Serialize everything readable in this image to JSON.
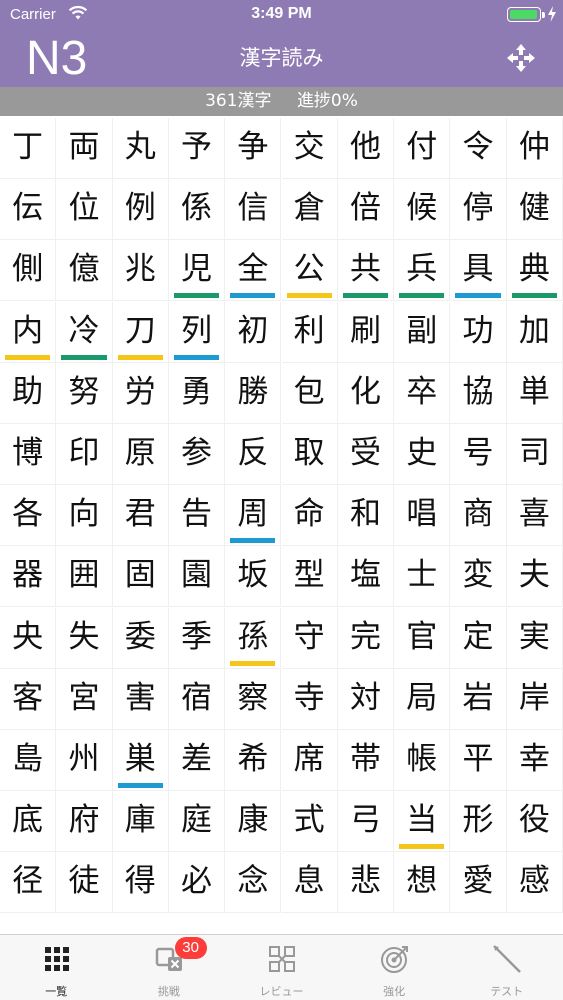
{
  "status_bar": {
    "carrier": "Carrier",
    "time": "3:49 PM"
  },
  "header": {
    "level": "N3",
    "title": "漢字読み",
    "shuffle_icon": "shuffle-icon"
  },
  "progress": {
    "count_text": "361漢字",
    "progress_text": "進捗0%"
  },
  "colors": {
    "theme": "#8f7bb4",
    "green": "#1a9a6b",
    "yellow": "#f5c517",
    "blue": "#1d9bd1"
  },
  "grid": {
    "cells": [
      {
        "k": "丁",
        "mark": ""
      },
      {
        "k": "両",
        "mark": ""
      },
      {
        "k": "丸",
        "mark": ""
      },
      {
        "k": "予",
        "mark": ""
      },
      {
        "k": "争",
        "mark": ""
      },
      {
        "k": "交",
        "mark": ""
      },
      {
        "k": "他",
        "mark": ""
      },
      {
        "k": "付",
        "mark": ""
      },
      {
        "k": "令",
        "mark": ""
      },
      {
        "k": "仲",
        "mark": ""
      },
      {
        "k": "伝",
        "mark": ""
      },
      {
        "k": "位",
        "mark": ""
      },
      {
        "k": "例",
        "mark": ""
      },
      {
        "k": "係",
        "mark": ""
      },
      {
        "k": "信",
        "mark": ""
      },
      {
        "k": "倉",
        "mark": ""
      },
      {
        "k": "倍",
        "mark": ""
      },
      {
        "k": "候",
        "mark": ""
      },
      {
        "k": "停",
        "mark": ""
      },
      {
        "k": "健",
        "mark": ""
      },
      {
        "k": "側",
        "mark": ""
      },
      {
        "k": "億",
        "mark": ""
      },
      {
        "k": "兆",
        "mark": ""
      },
      {
        "k": "児",
        "mark": "green"
      },
      {
        "k": "全",
        "mark": "blue"
      },
      {
        "k": "公",
        "mark": "yellow"
      },
      {
        "k": "共",
        "mark": "green"
      },
      {
        "k": "兵",
        "mark": "green"
      },
      {
        "k": "具",
        "mark": "blue"
      },
      {
        "k": "典",
        "mark": "green"
      },
      {
        "k": "内",
        "mark": "yellow"
      },
      {
        "k": "冷",
        "mark": "green"
      },
      {
        "k": "刀",
        "mark": "yellow"
      },
      {
        "k": "列",
        "mark": "blue"
      },
      {
        "k": "初",
        "mark": ""
      },
      {
        "k": "利",
        "mark": ""
      },
      {
        "k": "刷",
        "mark": ""
      },
      {
        "k": "副",
        "mark": ""
      },
      {
        "k": "功",
        "mark": ""
      },
      {
        "k": "加",
        "mark": ""
      },
      {
        "k": "助",
        "mark": ""
      },
      {
        "k": "努",
        "mark": ""
      },
      {
        "k": "労",
        "mark": ""
      },
      {
        "k": "勇",
        "mark": ""
      },
      {
        "k": "勝",
        "mark": ""
      },
      {
        "k": "包",
        "mark": ""
      },
      {
        "k": "化",
        "mark": ""
      },
      {
        "k": "卒",
        "mark": ""
      },
      {
        "k": "協",
        "mark": ""
      },
      {
        "k": "単",
        "mark": ""
      },
      {
        "k": "博",
        "mark": ""
      },
      {
        "k": "印",
        "mark": ""
      },
      {
        "k": "原",
        "mark": ""
      },
      {
        "k": "参",
        "mark": ""
      },
      {
        "k": "反",
        "mark": ""
      },
      {
        "k": "取",
        "mark": ""
      },
      {
        "k": "受",
        "mark": ""
      },
      {
        "k": "史",
        "mark": ""
      },
      {
        "k": "号",
        "mark": ""
      },
      {
        "k": "司",
        "mark": ""
      },
      {
        "k": "各",
        "mark": ""
      },
      {
        "k": "向",
        "mark": ""
      },
      {
        "k": "君",
        "mark": ""
      },
      {
        "k": "告",
        "mark": ""
      },
      {
        "k": "周",
        "mark": "blue"
      },
      {
        "k": "命",
        "mark": ""
      },
      {
        "k": "和",
        "mark": ""
      },
      {
        "k": "唱",
        "mark": ""
      },
      {
        "k": "商",
        "mark": ""
      },
      {
        "k": "喜",
        "mark": ""
      },
      {
        "k": "器",
        "mark": ""
      },
      {
        "k": "囲",
        "mark": ""
      },
      {
        "k": "固",
        "mark": ""
      },
      {
        "k": "園",
        "mark": ""
      },
      {
        "k": "坂",
        "mark": ""
      },
      {
        "k": "型",
        "mark": ""
      },
      {
        "k": "塩",
        "mark": ""
      },
      {
        "k": "士",
        "mark": ""
      },
      {
        "k": "変",
        "mark": ""
      },
      {
        "k": "夫",
        "mark": ""
      },
      {
        "k": "央",
        "mark": ""
      },
      {
        "k": "失",
        "mark": ""
      },
      {
        "k": "委",
        "mark": ""
      },
      {
        "k": "季",
        "mark": ""
      },
      {
        "k": "孫",
        "mark": "yellow"
      },
      {
        "k": "守",
        "mark": ""
      },
      {
        "k": "完",
        "mark": ""
      },
      {
        "k": "官",
        "mark": ""
      },
      {
        "k": "定",
        "mark": ""
      },
      {
        "k": "実",
        "mark": ""
      },
      {
        "k": "客",
        "mark": ""
      },
      {
        "k": "宮",
        "mark": ""
      },
      {
        "k": "害",
        "mark": ""
      },
      {
        "k": "宿",
        "mark": ""
      },
      {
        "k": "察",
        "mark": ""
      },
      {
        "k": "寺",
        "mark": ""
      },
      {
        "k": "対",
        "mark": ""
      },
      {
        "k": "局",
        "mark": ""
      },
      {
        "k": "岩",
        "mark": ""
      },
      {
        "k": "岸",
        "mark": ""
      },
      {
        "k": "島",
        "mark": ""
      },
      {
        "k": "州",
        "mark": ""
      },
      {
        "k": "巣",
        "mark": "blue"
      },
      {
        "k": "差",
        "mark": ""
      },
      {
        "k": "希",
        "mark": ""
      },
      {
        "k": "席",
        "mark": ""
      },
      {
        "k": "帯",
        "mark": ""
      },
      {
        "k": "帳",
        "mark": ""
      },
      {
        "k": "平",
        "mark": ""
      },
      {
        "k": "幸",
        "mark": ""
      },
      {
        "k": "底",
        "mark": ""
      },
      {
        "k": "府",
        "mark": ""
      },
      {
        "k": "庫",
        "mark": ""
      },
      {
        "k": "庭",
        "mark": ""
      },
      {
        "k": "康",
        "mark": ""
      },
      {
        "k": "式",
        "mark": ""
      },
      {
        "k": "弓",
        "mark": ""
      },
      {
        "k": "当",
        "mark": "yellow"
      },
      {
        "k": "形",
        "mark": ""
      },
      {
        "k": "役",
        "mark": ""
      },
      {
        "k": "径",
        "mark": ""
      },
      {
        "k": "徒",
        "mark": ""
      },
      {
        "k": "得",
        "mark": ""
      },
      {
        "k": "必",
        "mark": ""
      },
      {
        "k": "念",
        "mark": ""
      },
      {
        "k": "息",
        "mark": ""
      },
      {
        "k": "悲",
        "mark": ""
      },
      {
        "k": "想",
        "mark": ""
      },
      {
        "k": "愛",
        "mark": ""
      },
      {
        "k": "感",
        "mark": ""
      }
    ]
  },
  "tabs": [
    {
      "label": "一覧",
      "icon": "grid-icon",
      "active": true
    },
    {
      "label": "挑戦",
      "icon": "challenge-icon",
      "badge": "30"
    },
    {
      "label": "レビュー",
      "icon": "review-icon"
    },
    {
      "label": "強化",
      "icon": "target-icon"
    },
    {
      "label": "テスト",
      "icon": "pen-icon"
    }
  ]
}
